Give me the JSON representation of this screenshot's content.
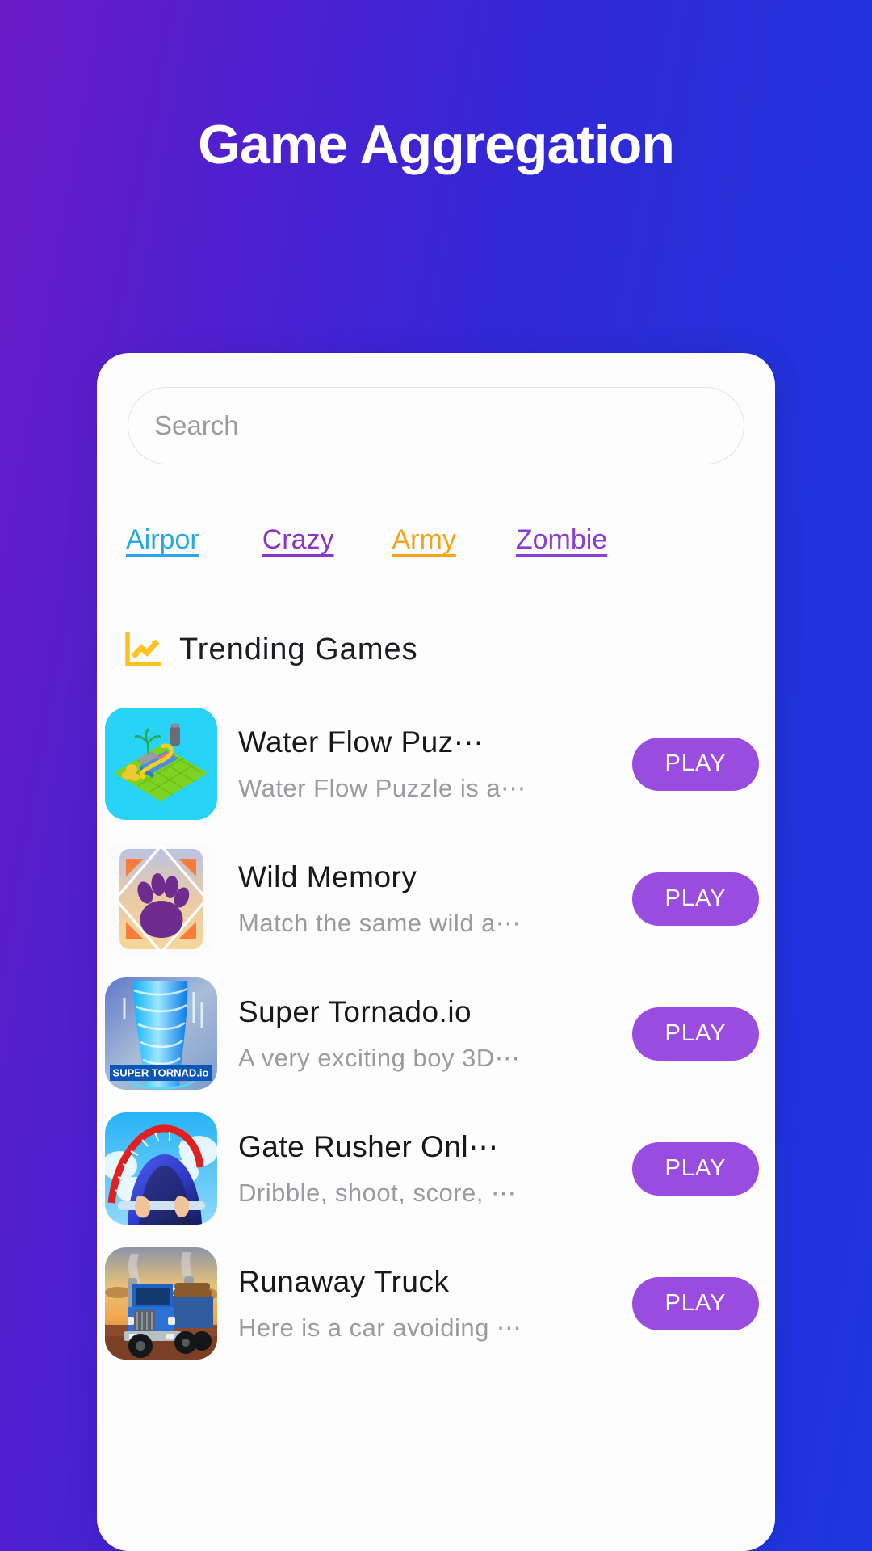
{
  "header": {
    "title": "Game Aggregation"
  },
  "theme": {
    "bg_start": "#6a1bc6",
    "bg_end": "#1c36e0",
    "card_bg": "#fdfdfd",
    "play_button": "#9b4ce0",
    "trend_icon": "#fcc322"
  },
  "search": {
    "placeholder": "Search",
    "value": ""
  },
  "categories": [
    {
      "label": "Airpor",
      "color": "#28a8e8"
    },
    {
      "label": "Crazy",
      "color": "#8b35c9"
    },
    {
      "label": "Army",
      "color": "#f3a41b"
    },
    {
      "label": "Zombie",
      "color": "#8b3fd9"
    }
  ],
  "trending": {
    "icon": "trending-chart-icon",
    "title": "Trending Games"
  },
  "games": [
    {
      "title": "Water Flow Puz⋯",
      "desc": "Water Flow Puzzle is a⋯",
      "play_label": "PLAY",
      "icon": "water-flow-puzzle-thumbnail"
    },
    {
      "title": "Wild Memory",
      "desc": "Match the same wild a⋯",
      "play_label": "PLAY",
      "icon": "wild-memory-thumbnail"
    },
    {
      "title": "Super Tornado.io",
      "desc": "A very exciting boy 3D⋯",
      "play_label": "PLAY",
      "icon": "super-tornado-thumbnail",
      "icon_banner": "SUPER TORNAD.io"
    },
    {
      "title": "Gate Rusher Onl⋯",
      "desc": "Dribble, shoot, score, ⋯",
      "play_label": "PLAY",
      "icon": "gate-rusher-thumbnail"
    },
    {
      "title": "Runaway Truck",
      "desc": "Here is a car avoiding ⋯",
      "play_label": "PLAY",
      "icon": "runaway-truck-thumbnail"
    }
  ]
}
